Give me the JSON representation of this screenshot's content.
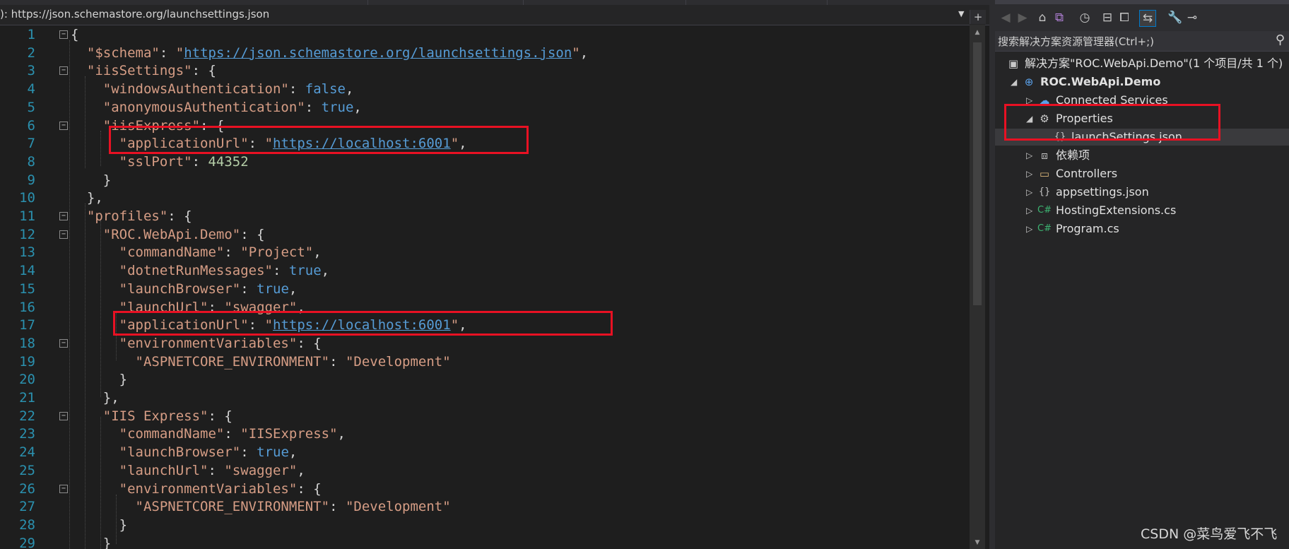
{
  "navbar": {
    "path_label": "): https://json.schemastore.org/launchsettings.json",
    "split_icon": "split-icon"
  },
  "code": {
    "lines": [
      {
        "n": "1",
        "fold": "−",
        "parts": [
          [
            "p",
            "{"
          ]
        ]
      },
      {
        "n": "2",
        "fold": "",
        "parts": [
          [
            "p",
            "  "
          ],
          [
            "k",
            "\"$schema\""
          ],
          [
            "p",
            ": "
          ],
          [
            "v",
            "\""
          ],
          [
            "url",
            "https://json.schemastore.org/launchsettings.json"
          ],
          [
            "v",
            "\""
          ],
          [
            "p",
            ","
          ]
        ]
      },
      {
        "n": "3",
        "fold": "−",
        "parts": [
          [
            "p",
            "  "
          ],
          [
            "k",
            "\"iisSettings\""
          ],
          [
            "p",
            ": {"
          ]
        ]
      },
      {
        "n": "4",
        "fold": "",
        "parts": [
          [
            "p",
            "    "
          ],
          [
            "k",
            "\"windowsAuthentication\""
          ],
          [
            "p",
            ": "
          ],
          [
            "kw",
            "false"
          ],
          [
            "p",
            ","
          ]
        ]
      },
      {
        "n": "5",
        "fold": "",
        "parts": [
          [
            "p",
            "    "
          ],
          [
            "k",
            "\"anonymousAuthentication\""
          ],
          [
            "p",
            ": "
          ],
          [
            "kw",
            "true"
          ],
          [
            "p",
            ","
          ]
        ]
      },
      {
        "n": "6",
        "fold": "−",
        "parts": [
          [
            "p",
            "    "
          ],
          [
            "k",
            "\"iisExpress\""
          ],
          [
            "p",
            ": {"
          ]
        ]
      },
      {
        "n": "7",
        "fold": "",
        "parts": [
          [
            "p",
            "      "
          ],
          [
            "k",
            "\"applicationUrl\""
          ],
          [
            "p",
            ": "
          ],
          [
            "v",
            "\""
          ],
          [
            "url",
            "https://localhost:6001"
          ],
          [
            "v",
            "\""
          ],
          [
            "p",
            ","
          ]
        ]
      },
      {
        "n": "8",
        "fold": "",
        "parts": [
          [
            "p",
            "      "
          ],
          [
            "k",
            "\"sslPort\""
          ],
          [
            "p",
            ": "
          ],
          [
            "num",
            "44352"
          ]
        ]
      },
      {
        "n": "9",
        "fold": "",
        "parts": [
          [
            "p",
            "    }"
          ]
        ]
      },
      {
        "n": "10",
        "fold": "",
        "parts": [
          [
            "p",
            "  },"
          ]
        ]
      },
      {
        "n": "11",
        "fold": "−",
        "parts": [
          [
            "p",
            "  "
          ],
          [
            "k",
            "\"profiles\""
          ],
          [
            "p",
            ": {"
          ]
        ]
      },
      {
        "n": "12",
        "fold": "−",
        "parts": [
          [
            "p",
            "    "
          ],
          [
            "k",
            "\"ROC.WebApi.Demo\""
          ],
          [
            "p",
            ": {"
          ]
        ]
      },
      {
        "n": "13",
        "fold": "",
        "parts": [
          [
            "p",
            "      "
          ],
          [
            "k",
            "\"commandName\""
          ],
          [
            "p",
            ": "
          ],
          [
            "v",
            "\"Project\""
          ],
          [
            "p",
            ","
          ]
        ]
      },
      {
        "n": "14",
        "fold": "",
        "parts": [
          [
            "p",
            "      "
          ],
          [
            "k",
            "\"dotnetRunMessages\""
          ],
          [
            "p",
            ": "
          ],
          [
            "kw",
            "true"
          ],
          [
            "p",
            ","
          ]
        ]
      },
      {
        "n": "15",
        "fold": "",
        "parts": [
          [
            "p",
            "      "
          ],
          [
            "k",
            "\"launchBrowser\""
          ],
          [
            "p",
            ": "
          ],
          [
            "kw",
            "true"
          ],
          [
            "p",
            ","
          ]
        ]
      },
      {
        "n": "16",
        "fold": "",
        "parts": [
          [
            "p",
            "      "
          ],
          [
            "k",
            "\"launchUrl\""
          ],
          [
            "p",
            ": "
          ],
          [
            "v",
            "\"swagger\""
          ],
          [
            "p",
            ","
          ]
        ]
      },
      {
        "n": "17",
        "fold": "",
        "parts": [
          [
            "p",
            "      "
          ],
          [
            "k",
            "\"applicationUrl\""
          ],
          [
            "p",
            ": "
          ],
          [
            "v",
            "\""
          ],
          [
            "url",
            "https://localhost:6001"
          ],
          [
            "v",
            "\""
          ],
          [
            "p",
            ","
          ]
        ]
      },
      {
        "n": "18",
        "fold": "−",
        "parts": [
          [
            "p",
            "      "
          ],
          [
            "k",
            "\"environmentVariables\""
          ],
          [
            "p",
            ": {"
          ]
        ]
      },
      {
        "n": "19",
        "fold": "",
        "parts": [
          [
            "p",
            "        "
          ],
          [
            "k",
            "\"ASPNETCORE_ENVIRONMENT\""
          ],
          [
            "p",
            ": "
          ],
          [
            "v",
            "\"Development\""
          ]
        ]
      },
      {
        "n": "20",
        "fold": "",
        "parts": [
          [
            "p",
            "      }"
          ]
        ]
      },
      {
        "n": "21",
        "fold": "",
        "parts": [
          [
            "p",
            "    },"
          ]
        ]
      },
      {
        "n": "22",
        "fold": "−",
        "parts": [
          [
            "p",
            "    "
          ],
          [
            "k",
            "\"IIS Express\""
          ],
          [
            "p",
            ": {"
          ]
        ]
      },
      {
        "n": "23",
        "fold": "",
        "parts": [
          [
            "p",
            "      "
          ],
          [
            "k",
            "\"commandName\""
          ],
          [
            "p",
            ": "
          ],
          [
            "v",
            "\"IISExpress\""
          ],
          [
            "p",
            ","
          ]
        ]
      },
      {
        "n": "24",
        "fold": "",
        "parts": [
          [
            "p",
            "      "
          ],
          [
            "k",
            "\"launchBrowser\""
          ],
          [
            "p",
            ": "
          ],
          [
            "kw",
            "true"
          ],
          [
            "p",
            ","
          ]
        ]
      },
      {
        "n": "25",
        "fold": "",
        "parts": [
          [
            "p",
            "      "
          ],
          [
            "k",
            "\"launchUrl\""
          ],
          [
            "p",
            ": "
          ],
          [
            "v",
            "\"swagger\""
          ],
          [
            "p",
            ","
          ]
        ]
      },
      {
        "n": "26",
        "fold": "−",
        "parts": [
          [
            "p",
            "      "
          ],
          [
            "k",
            "\"environmentVariables\""
          ],
          [
            "p",
            ": {"
          ]
        ]
      },
      {
        "n": "27",
        "fold": "",
        "parts": [
          [
            "p",
            "        "
          ],
          [
            "k",
            "\"ASPNETCORE_ENVIRONMENT\""
          ],
          [
            "p",
            ": "
          ],
          [
            "v",
            "\"Development\""
          ]
        ]
      },
      {
        "n": "28",
        "fold": "",
        "parts": [
          [
            "p",
            "      }"
          ]
        ]
      },
      {
        "n": "29",
        "fold": "",
        "parts": [
          [
            "p",
            "    }"
          ]
        ]
      }
    ]
  },
  "solution_explorer": {
    "toolbar_icons": [
      "back-icon",
      "forward-icon",
      "home-icon",
      "vs-switch-views-icon",
      "pending-changes-filter-icon",
      "collapse-all-icon",
      "show-all-files-icon",
      "sync-active-document-icon",
      "properties-wrench-icon",
      "preview-selected-icon"
    ],
    "search_placeholder": "搜索解决方案资源管理器(Ctrl+;)",
    "tree": [
      {
        "label": "解决方案\"ROC.WebApi.Demo\"(1 个项目/共 1 个)",
        "icon": "solution-icon",
        "depth": 0,
        "twisty": "",
        "bold": false,
        "selected": false
      },
      {
        "label": "ROC.WebApi.Demo",
        "icon": "web-project-icon",
        "depth": 1,
        "twisty": "◢",
        "bold": true,
        "selected": false
      },
      {
        "label": "Connected Services",
        "icon": "connected-services-icon",
        "depth": 2,
        "twisty": "▷",
        "bold": false,
        "selected": false
      },
      {
        "label": "Properties",
        "icon": "properties-wrench-icon",
        "depth": 2,
        "twisty": "◢",
        "bold": false,
        "selected": false
      },
      {
        "label": "launchSettings.json",
        "icon": "json-file-icon",
        "depth": 3,
        "twisty": "",
        "bold": false,
        "selected": true
      },
      {
        "label": "依赖项",
        "icon": "dependencies-icon",
        "depth": 2,
        "twisty": "▷",
        "bold": false,
        "selected": false
      },
      {
        "label": "Controllers",
        "icon": "folder-icon",
        "depth": 2,
        "twisty": "▷",
        "bold": false,
        "selected": false
      },
      {
        "label": "appsettings.json",
        "icon": "json-file-icon",
        "depth": 2,
        "twisty": "▷",
        "bold": false,
        "selected": false
      },
      {
        "label": "HostingExtensions.cs",
        "icon": "csharp-file-icon",
        "depth": 2,
        "twisty": "▷",
        "bold": false,
        "selected": false
      },
      {
        "label": "Program.cs",
        "icon": "csharp-file-icon",
        "depth": 2,
        "twisty": "▷",
        "bold": false,
        "selected": false
      }
    ]
  },
  "watermark": "CSDN @菜鸟爱飞不飞",
  "colors": {
    "highlight_box": "#e81123",
    "accent": "#007acc"
  }
}
